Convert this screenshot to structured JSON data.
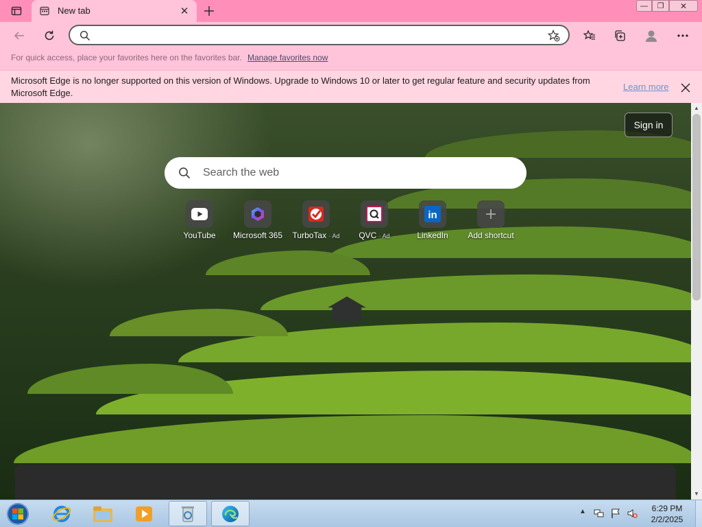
{
  "tabs": [
    {
      "title": "New tab"
    }
  ],
  "window_controls": {
    "minimize": "—",
    "maximize": "❐",
    "close": "✕"
  },
  "address_bar": {
    "value": "",
    "placeholder": ""
  },
  "favorites_bar": {
    "hint": "For quick access, place your favorites here on the favorites bar.",
    "manage_link": "Manage favorites now"
  },
  "info_bar": {
    "message": "Microsoft Edge is no longer supported on this version of Windows. Upgrade to Windows 10 or later to get regular feature and security updates from Microsoft Edge.",
    "learn_more": "Learn more"
  },
  "new_tab_page": {
    "sign_in": "Sign in",
    "search_placeholder": "Search the web",
    "shortcuts": [
      {
        "label": "YouTube",
        "ad": "",
        "icon": "youtube-icon"
      },
      {
        "label": "Microsoft 365",
        "ad": "",
        "icon": "microsoft365-icon"
      },
      {
        "label": "TurboTax",
        "ad": "· Ad",
        "icon": "turbotax-icon"
      },
      {
        "label": "QVC",
        "ad": "· Ad",
        "icon": "qvc-icon"
      },
      {
        "label": "LinkedIn",
        "ad": "",
        "icon": "linkedin-icon"
      },
      {
        "label": "Add shortcut",
        "ad": "",
        "icon": "plus-icon"
      }
    ]
  },
  "taskbar": {
    "apps": [
      "internet-explorer-icon",
      "file-explorer-icon",
      "media-player-icon",
      "recycle-tool-icon",
      "edge-icon"
    ],
    "clock": {
      "time": "6:29 PM",
      "date": "2/2/2025"
    }
  },
  "colors": {
    "chrome": "#ff8fb8",
    "toolbar": "#ffc3da",
    "infobar": "#ffd6e2"
  }
}
